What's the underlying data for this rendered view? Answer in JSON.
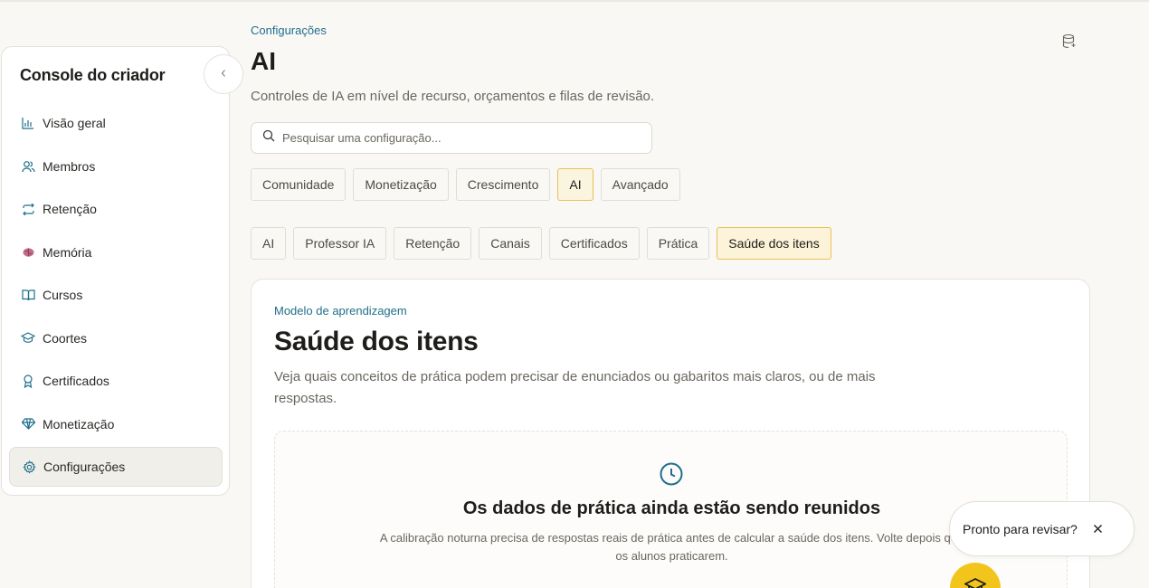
{
  "sidebar": {
    "title": "Console do criador",
    "items": [
      {
        "label": "Visão geral",
        "icon": "bar-chart-icon"
      },
      {
        "label": "Membros",
        "icon": "users-icon"
      },
      {
        "label": "Retenção",
        "icon": "repeat-icon"
      },
      {
        "label": "Memória",
        "icon": "brain-icon"
      },
      {
        "label": "Cursos",
        "icon": "book-icon"
      },
      {
        "label": "Coortes",
        "icon": "graduation-cap-icon"
      },
      {
        "label": "Certificados",
        "icon": "award-icon"
      },
      {
        "label": "Monetização",
        "icon": "diamond-icon"
      },
      {
        "label": "Configurações",
        "icon": "gear-icon",
        "active": true
      }
    ]
  },
  "header": {
    "breadcrumb": "Configurações",
    "title": "AI",
    "subtitle": "Controles de IA em nível de recurso, orçamentos e filas de revisão."
  },
  "search": {
    "placeholder": "Pesquisar uma configuração...",
    "value": ""
  },
  "tabs": {
    "top": [
      "Comunidade",
      "Monetização",
      "Crescimento",
      "AI",
      "Avançado"
    ],
    "top_selected": "AI",
    "sub": [
      "AI",
      "Professor IA",
      "Retenção",
      "Canais",
      "Certificados",
      "Prática",
      "Saúde dos itens"
    ],
    "sub_selected": "Saúde dos itens"
  },
  "card": {
    "eyebrow": "Modelo de aprendizagem",
    "title": "Saúde dos itens",
    "description": "Veja quais conceitos de prática podem precisar de enunciados ou gabaritos mais claros, ou de mais respostas.",
    "empty_state": {
      "icon": "clock-icon",
      "title": "Os dados de prática ainda estão sendo reunidos",
      "text": "A calibração noturna precisa de respostas reais de prática antes de calcular a saúde dos itens. Volte depois que os alunos praticarem."
    }
  },
  "toast": {
    "text": "Pronto para revisar?"
  },
  "colors": {
    "accent": "#1f6f8b",
    "highlight_border": "#e7c156",
    "highlight_bg": "#fbf4df",
    "fab": "#f2c51d",
    "background": "#f9f8f5"
  }
}
